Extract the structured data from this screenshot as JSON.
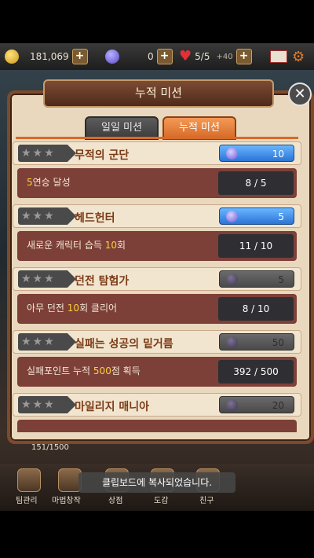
{
  "resources": {
    "coins": "181,069",
    "gems": "0",
    "hearts": "5/5",
    "hearts_bonus": "+40"
  },
  "bottom_nav": [
    {
      "label": "팀관리"
    },
    {
      "label": "마법창작"
    },
    {
      "label": "상점"
    },
    {
      "label": "도감"
    },
    {
      "label": "친구"
    }
  ],
  "exp_text": "151/1500",
  "popup": {
    "title": "누적 미션",
    "tabs": [
      {
        "label": "일일 미션"
      },
      {
        "label": "누적 미션"
      }
    ],
    "missions": [
      {
        "name": "무적의 군단",
        "reward": "10",
        "desc_pre": "",
        "desc_hl": "5",
        "desc_post": "연승 달성",
        "progress": "8 / 5",
        "claimable": true
      },
      {
        "name": "헤드헌터",
        "reward": "5",
        "desc_pre": "새로운 캐릭터 습득 ",
        "desc_hl": "10",
        "desc_post": "회",
        "progress": "11 / 10",
        "claimable": true
      },
      {
        "name": "던전 탐험가",
        "reward": "5",
        "desc_pre": "아무 던전 ",
        "desc_hl": "10",
        "desc_post": "회 클리어",
        "progress": "8 / 10",
        "claimable": false
      },
      {
        "name": "실패는 성공의 밑거름",
        "reward": "50",
        "desc_pre": "실패포인트 누적 ",
        "desc_hl": "500",
        "desc_post": "점 획득",
        "progress": "392 / 500",
        "claimable": false
      },
      {
        "name": "마일리지 매니아",
        "reward": "20",
        "desc_pre": "",
        "desc_hl": "",
        "desc_post": "",
        "progress": "",
        "claimable": false
      }
    ]
  },
  "toast": "클립보드에 복사되었습니다."
}
